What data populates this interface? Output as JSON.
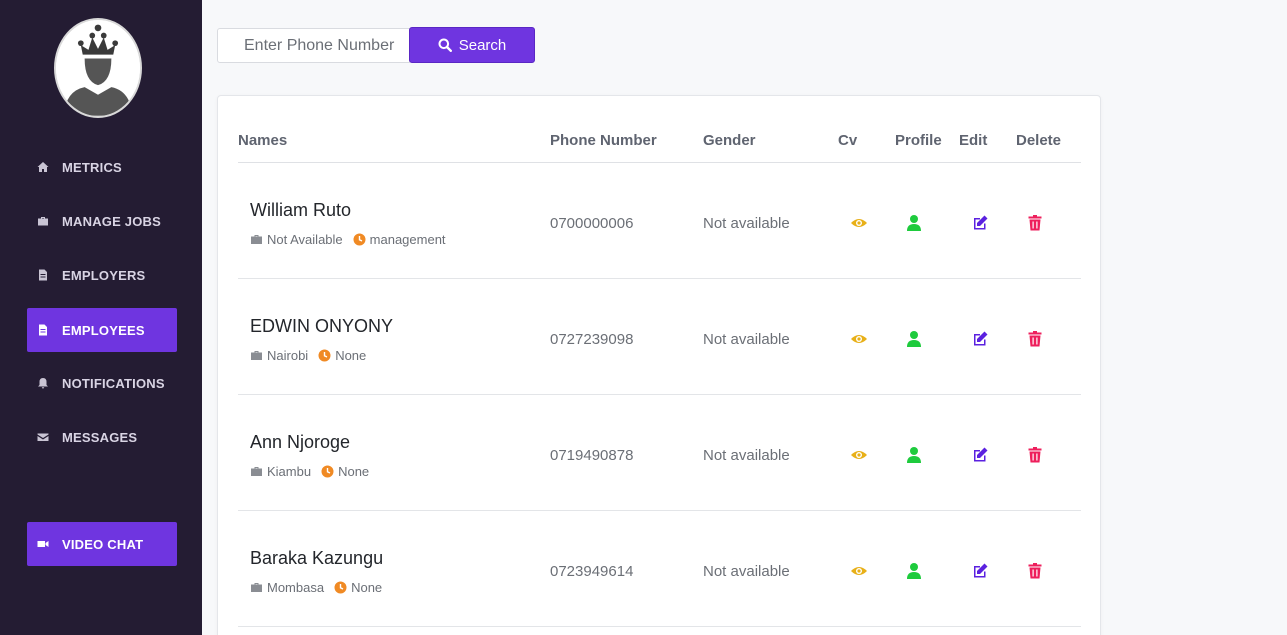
{
  "sidebar": {
    "items": [
      {
        "label": "METRICS",
        "icon": "home-icon"
      },
      {
        "label": "MANAGE JOBS",
        "icon": "briefcase-icon"
      },
      {
        "label": "EMPLOYERS",
        "icon": "document-icon"
      },
      {
        "label": "EMPLOYEES",
        "icon": "document-icon",
        "active": true
      },
      {
        "label": "NOTIFICATIONS",
        "icon": "bell-icon"
      },
      {
        "label": "MESSAGES",
        "icon": "envelope-icon"
      }
    ],
    "video_chat": {
      "label": "VIDEO CHAT",
      "icon": "video-camera-icon"
    }
  },
  "search": {
    "placeholder": "Enter Phone Number",
    "button_label": "Search",
    "icon": "search-icon"
  },
  "table": {
    "headers": {
      "names": "Names",
      "phone": "Phone Number",
      "gender": "Gender",
      "cv": "Cv",
      "profile": "Profile",
      "edit": "Edit",
      "delete": "Delete"
    },
    "rows": [
      {
        "name": "William Ruto",
        "location": "Not Available",
        "category": "management",
        "phone": "0700000006",
        "gender": "Not available"
      },
      {
        "name": "EDWIN ONYONY",
        "location": "Nairobi",
        "category": "None",
        "phone": "0727239098",
        "gender": "Not available"
      },
      {
        "name": "Ann Njoroge",
        "location": "Kiambu",
        "category": "None",
        "phone": "0719490878",
        "gender": "Not available"
      },
      {
        "name": "Baraka Kazungu",
        "location": "Mombasa",
        "category": "None",
        "phone": "0723949614",
        "gender": "Not available"
      }
    ]
  },
  "colors": {
    "sidebar_bg": "#241c33",
    "accent": "#6f35e0",
    "cv_icon": "#e8b018",
    "profile_icon": "#1ecb3d",
    "edit_icon": "#5b21e0",
    "delete_icon": "#ee1f5c",
    "clock_icon": "#f08a24"
  }
}
